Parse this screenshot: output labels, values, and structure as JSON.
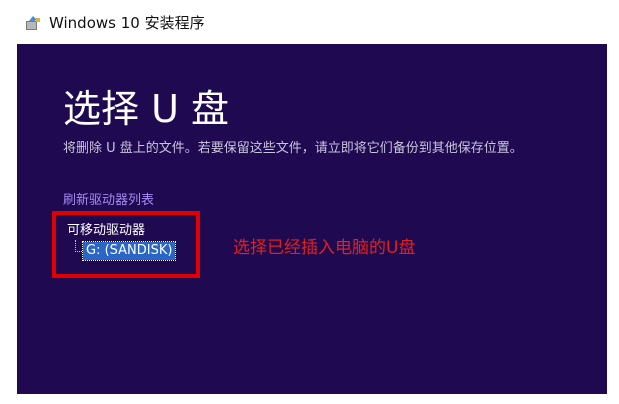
{
  "window": {
    "title": "Windows 10 安装程序",
    "icon": "setup-icon"
  },
  "page": {
    "heading": "选择 U 盘",
    "description": "将删除 U 盘上的文件。若要保留这些文件，请立即将它们备份到其他保存位置。",
    "refresh_link": "刷新驱动器列表"
  },
  "drive_tree": {
    "root_label": "可移动驱动器",
    "items": [
      {
        "label": "G: (SANDISK)",
        "selected": true
      }
    ]
  },
  "annotation": {
    "text": "选择已经插入电脑的U盘",
    "color": "#e12020"
  },
  "colors": {
    "background": "#1f0a52",
    "link": "#a58bf2",
    "selection": "#2a66c8",
    "highlight_border": "#e00000"
  }
}
